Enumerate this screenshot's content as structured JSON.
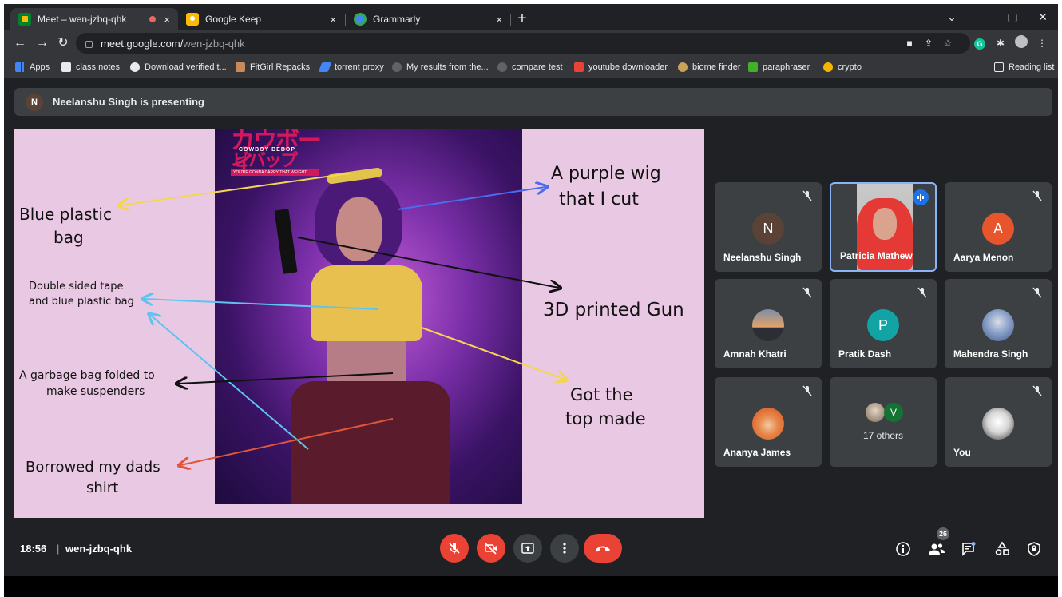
{
  "browser": {
    "tabs": [
      {
        "title": "Meet – wen-jzbq-qhk",
        "close": "×"
      },
      {
        "title": "Google Keep",
        "close": "×"
      },
      {
        "title": "Grammarly",
        "close": "×"
      }
    ],
    "new_tab": "+",
    "url_host": "meet.google.com/",
    "url_path": "wen-jzbq-qhk",
    "bookmarks": [
      "Apps",
      "class notes",
      "Download verified t...",
      "FitGirl Repacks",
      "torrent proxy",
      "My results from the...",
      "compare test",
      "youtube downloader",
      "biome finder",
      "paraphraser",
      "crypto"
    ],
    "reading_list": "Reading list"
  },
  "presenting": {
    "initial": "N",
    "text": "Neelanshu Singh is presenting"
  },
  "slide": {
    "magazine_title": "カウボーイ",
    "magazine_title2": "ビバップ",
    "magazine_sub": "COWBOY BEBOP",
    "magazine_strap": "YOU'RE GONNA CARRY THAT WEIGHT",
    "annotations": {
      "blue_bag_1": "Blue plastic",
      "blue_bag_2": "bag",
      "tape_1": "Double sided tape",
      "tape_2": "and blue plastic bag",
      "garbage_1": "A garbage bag folded to",
      "garbage_2": "make suspenders",
      "shirt_1": "Borrowed my dads",
      "shirt_2": "shirt",
      "wig_1": "A purple wig",
      "wig_2": "that I cut",
      "gun": "3D printed Gun",
      "top_1": "Got the",
      "top_2": "top made"
    },
    "arrow_colors": {
      "yellow": "#f3d64e",
      "blue": "#4b6cf0",
      "cyan": "#5bc4f0",
      "black": "#111111",
      "red": "#e2553a"
    }
  },
  "participants": [
    {
      "name": "Neelanshu Singh",
      "initial": "N",
      "color": "#5b4236"
    },
    {
      "name": "Patricia Mathew",
      "initial": "",
      "color": ""
    },
    {
      "name": "Aarya Menon",
      "initial": "A",
      "color": "#e8542c"
    },
    {
      "name": "Amnah Khatri",
      "initial": "",
      "color": ""
    },
    {
      "name": "Pratik Dash",
      "initial": "P",
      "color": "#12a4a4"
    },
    {
      "name": "Mahendra Singh",
      "initial": "",
      "color": ""
    },
    {
      "name": "Ananya James",
      "initial": "",
      "color": ""
    },
    {
      "name": "",
      "initial": "V",
      "color": "#137333",
      "others": "17 others"
    },
    {
      "name": "You",
      "initial": "",
      "color": ""
    }
  ],
  "bottom": {
    "time": "18:56",
    "divider": "|",
    "meeting_code": "wen-jzbq-qhk",
    "participant_count": "26"
  },
  "colors": {
    "meet_bg": "#202124",
    "tile_bg": "#3c4043",
    "red": "#ea4335",
    "accent": "#8ab4f8"
  }
}
